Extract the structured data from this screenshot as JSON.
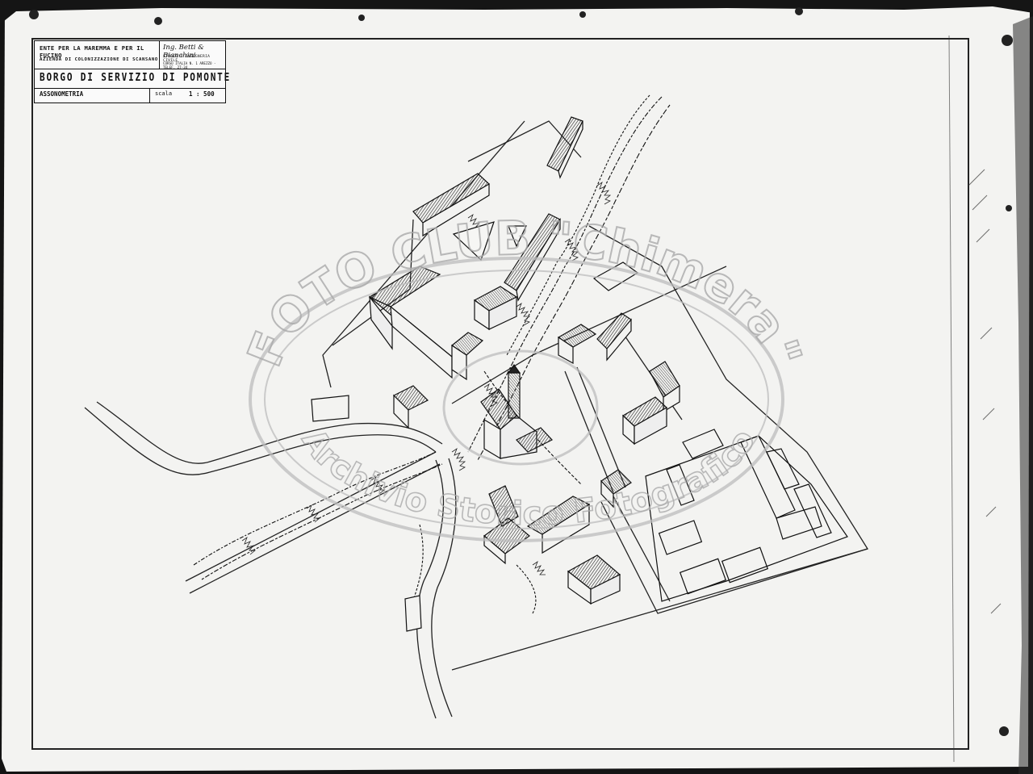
{
  "title_block": {
    "ente": "ENTE PER LA MAREMMA E PER IL FUCINO",
    "azienda": "AZIENDA DI COLONIZZAZIONE DI SCANSANO",
    "signature": "Ing. Betti & Bianchini",
    "studio": "STUDIO D'INGEGNERIA CIVILE",
    "address": "CORSO ITALIA N. 1 AREZZO - TELEF. 27-34",
    "title": "BORGO DI SERVIZIO DI POMONTE",
    "view_type": "ASSONOMETRIA",
    "scale_label": "scala",
    "scale_value": "1 : 500"
  },
  "watermark": {
    "top_text": "FOTO CLUB \"Chimera\"",
    "bottom_text": "Archivio Storico Fotografico"
  },
  "colors": {
    "paper": "#f4f4f2",
    "ink": "#1a1a1a",
    "background": "#151515",
    "watermark": "#c9c9c9"
  }
}
